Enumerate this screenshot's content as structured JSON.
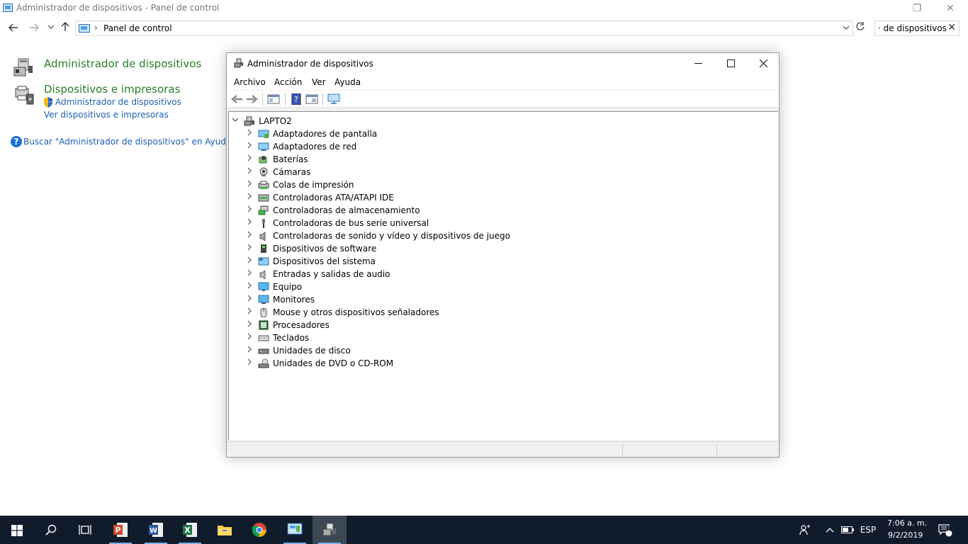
{
  "control_panel": {
    "window_title": "Administrador de dispositivos - Panel de control",
    "address": "Panel de control",
    "address_separator": "›",
    "search_text": "· de dispositivos",
    "results": [
      {
        "title": "Administrador de dispositivos",
        "links": []
      },
      {
        "title": "Dispositivos e impresoras",
        "links": [
          "Administrador de dispositivos",
          "Ver dispositivos e impresoras"
        ]
      }
    ],
    "help_link": "Buscar \"Administrador de dispositivos\" en Ayuda y sop"
  },
  "device_manager": {
    "title": "Administrador de dispositivos",
    "menu": [
      "Archivo",
      "Acción",
      "Ver",
      "Ayuda"
    ],
    "root": "LAPTO2",
    "categories": [
      {
        "label": "Adaptadores de pantalla",
        "icon": "display-adapter-icon"
      },
      {
        "label": "Adaptadores de red",
        "icon": "network-adapter-icon"
      },
      {
        "label": "Baterías",
        "icon": "battery-icon"
      },
      {
        "label": "Cámaras",
        "icon": "camera-icon"
      },
      {
        "label": "Colas de impresión",
        "icon": "print-queue-icon"
      },
      {
        "label": "Controladoras ATA/ATAPI IDE",
        "icon": "ide-controller-icon"
      },
      {
        "label": "Controladoras de almacenamiento",
        "icon": "storage-controller-icon"
      },
      {
        "label": "Controladoras de bus serie universal",
        "icon": "usb-icon"
      },
      {
        "label": "Controladoras de sonido y vídeo y dispositivos de juego",
        "icon": "sound-icon"
      },
      {
        "label": "Dispositivos de software",
        "icon": "software-device-icon"
      },
      {
        "label": "Dispositivos del sistema",
        "icon": "system-device-icon"
      },
      {
        "label": "Entradas y salidas de audio",
        "icon": "audio-io-icon"
      },
      {
        "label": "Equipo",
        "icon": "computer-icon"
      },
      {
        "label": "Monitores",
        "icon": "monitor-icon"
      },
      {
        "label": "Mouse y otros dispositivos señaladores",
        "icon": "mouse-icon"
      },
      {
        "label": "Procesadores",
        "icon": "processor-icon"
      },
      {
        "label": "Teclados",
        "icon": "keyboard-icon"
      },
      {
        "label": "Unidades de disco",
        "icon": "disk-drive-icon"
      },
      {
        "label": "Unidades de DVD o CD-ROM",
        "icon": "dvd-drive-icon"
      }
    ]
  },
  "taskbar": {
    "apps": [
      "start-icon",
      "search-icon",
      "task-view-icon",
      "powerpoint-icon",
      "word-icon",
      "excel-icon",
      "file-explorer-icon",
      "chrome-icon",
      "control-panel-icon",
      "device-manager-icon"
    ],
    "language": "ESP",
    "time": "7:06 a. m.",
    "date": "9/2/2019",
    "notifications_count": "1"
  },
  "colors": {
    "accent_green": "#267f26",
    "link_blue": "#1d5fb3",
    "taskbar_bg": "#101c2c"
  }
}
